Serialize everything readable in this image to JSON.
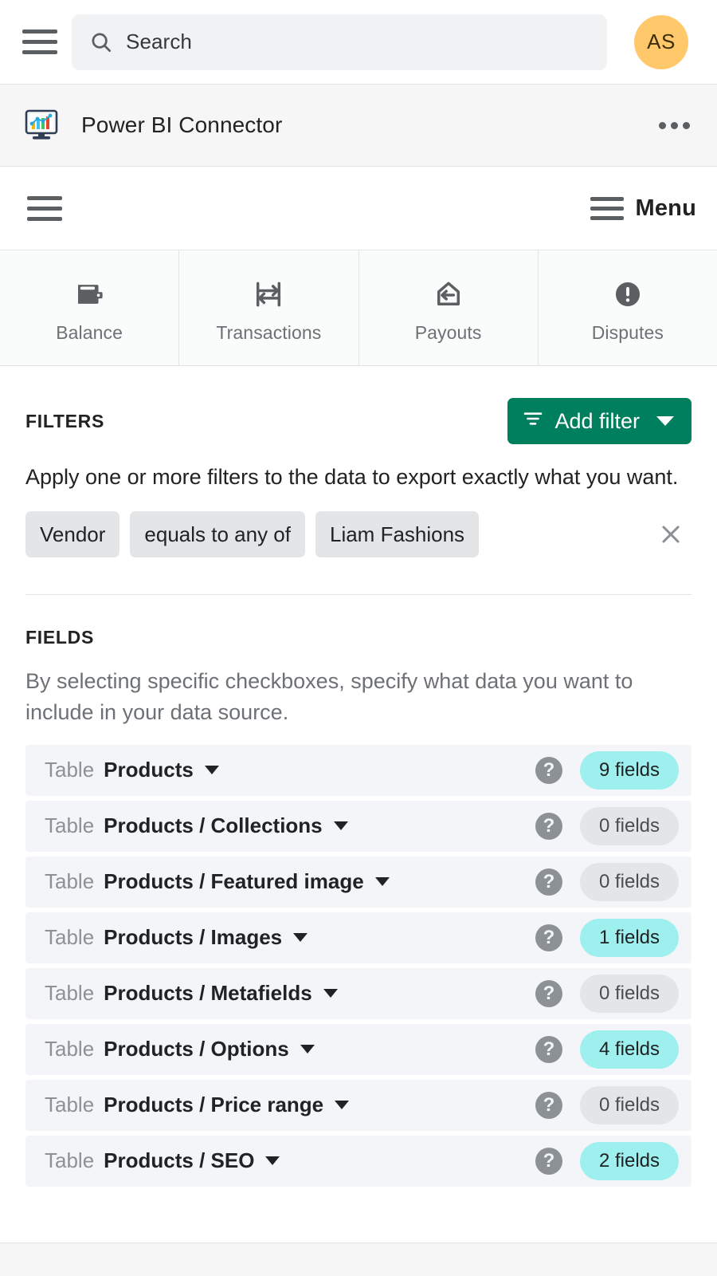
{
  "topbar": {
    "menu_icon": "hamburger-icon",
    "search": {
      "icon": "search-icon",
      "value": "",
      "placeholder": "Search",
      "display": "Search"
    },
    "avatar": {
      "initials": "AS",
      "color": "#ffc96b"
    }
  },
  "app_header": {
    "icon": "power-bi-connector-icon",
    "title": "Power BI Connector",
    "more_icon": "more-horizontal-icon"
  },
  "embed_nav": {
    "left_menu_icon": "hamburger-icon",
    "menu_label": "Menu",
    "menu_icon": "hamburger-icon"
  },
  "tabs": [
    {
      "label": "Balance",
      "icon": "wallet-icon"
    },
    {
      "label": "Transactions",
      "icon": "transfer-icon"
    },
    {
      "label": "Payouts",
      "icon": "bank-arrow-icon"
    },
    {
      "label": "Disputes",
      "icon": "alert-circle-icon"
    }
  ],
  "filters": {
    "title": "FILTERS",
    "add_button": {
      "label": "Add filter",
      "icon": "filter-icon",
      "caret": "chevron-down-icon",
      "color": "#007f5f"
    },
    "description": "Apply one or more filters to the data to export exactly what you want.",
    "rows": [
      {
        "field": "Vendor",
        "operator": "equals to any of",
        "value": "Liam Fashions",
        "remove_icon": "close-icon"
      }
    ]
  },
  "fields": {
    "title": "FIELDS",
    "description": "By selecting specific checkboxes, specify what data you want to include in your data source.",
    "type_label": "Table",
    "help_icon": "help-circle-icon",
    "caret_icon": "chevron-down-icon",
    "rows": [
      {
        "type": "Table",
        "name": "Products",
        "count": "9 fields",
        "selected": true
      },
      {
        "type": "Table",
        "name": "Products / Collections",
        "count": "0 fields",
        "selected": false
      },
      {
        "type": "Table",
        "name": "Products / Featured image",
        "count": "0 fields",
        "selected": false
      },
      {
        "type": "Table",
        "name": "Products / Images",
        "count": "1 fields",
        "selected": true
      },
      {
        "type": "Table",
        "name": "Products / Metafields",
        "count": "0 fields",
        "selected": false
      },
      {
        "type": "Table",
        "name": "Products / Options",
        "count": "4 fields",
        "selected": true
      },
      {
        "type": "Table",
        "name": "Products / Price range",
        "count": "0 fields",
        "selected": false
      },
      {
        "type": "Table",
        "name": "Products / SEO",
        "count": "2 fields",
        "selected": true
      }
    ]
  },
  "colors": {
    "accent_green": "#007f5f",
    "badge_on": "#9ef0ef",
    "badge_off": "#e4e5e7",
    "row_bg": "#f4f5f8",
    "avatar": "#ffc96b"
  }
}
